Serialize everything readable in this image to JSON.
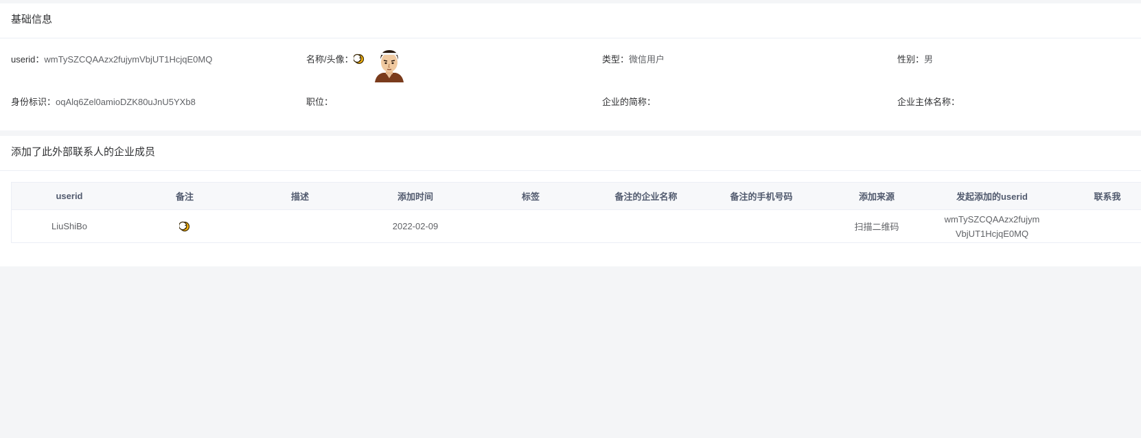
{
  "basic": {
    "title": "基础信息",
    "userid_label": "userid：",
    "userid_value": "wmTySZCQAAzx2fujymVbjUT1HcjqE0MQ",
    "name_label": "名称/头像：",
    "name_icon": "crescent-moon-emoji",
    "avatar_icon": "user-avatar",
    "type_label": "类型：",
    "type_value": "微信用户",
    "gender_label": "性别：",
    "gender_value": "男",
    "identity_label": "身份标识：",
    "identity_value": "oqAlq6Zel0amioDZK80uJnU5YXb8",
    "position_label": "职位：",
    "position_value": "",
    "corp_short_label": "企业的简称：",
    "corp_short_value": "",
    "corp_full_label": "企业主体名称：",
    "corp_full_value": ""
  },
  "members": {
    "title": "添加了此外部联系人的企业成员",
    "columns": [
      "userid",
      "备注",
      "描述",
      "添加时间",
      "标签",
      "备注的企业名称",
      "备注的手机号码",
      "添加来源",
      "发起添加的userid",
      "联系我"
    ],
    "rows": [
      {
        "userid": "LiuShiBo",
        "remark_icon": "crescent-moon-emoji",
        "description": "",
        "add_time": "2022-02-09",
        "tags": "",
        "remark_corp": "",
        "remark_mobile": "",
        "source": "扫描二维码",
        "oper_userid": "wmTySZCQAAzx2fujymVbjUT1HcjqE0MQ",
        "contact_me": ""
      }
    ]
  }
}
